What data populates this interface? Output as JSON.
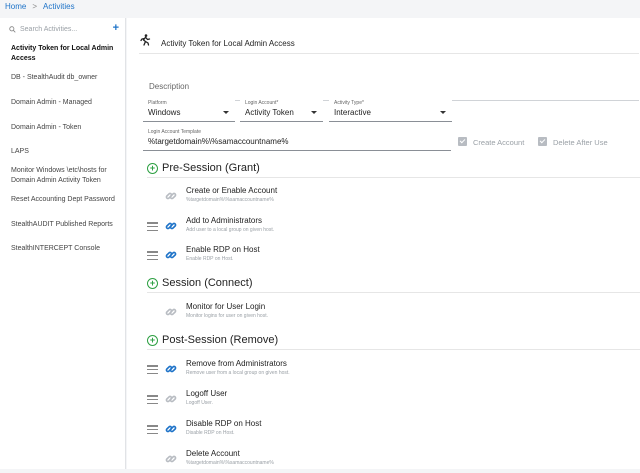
{
  "breadcrumb": {
    "home": "Home",
    "current": "Activities",
    "separator": ">"
  },
  "sidebar": {
    "search_placeholder": "Search Activities...",
    "add_label": "+",
    "items": [
      {
        "label": "Activity Token for Local Admin Access"
      },
      {
        "label": "DB - StealthAudit db_owner"
      },
      {
        "label": "Domain Admin - Managed"
      },
      {
        "label": "Domain Admin - Token"
      },
      {
        "label": "LAPS"
      },
      {
        "label": "Monitor Windows \\etc\\hosts for Domain Admin Activity Token"
      },
      {
        "label": "Reset Accounting Dept Password"
      },
      {
        "label": "StealthAUDIT Published Reports"
      },
      {
        "label": "StealthINTERCEPT Console"
      }
    ]
  },
  "activity": {
    "title": "Activity Token for Local Admin Access",
    "description_placeholder": "Description",
    "platform": {
      "label": "Platform",
      "value": "Windows"
    },
    "login_account": {
      "label": "Login Account*",
      "value": "Activity Token"
    },
    "activity_type": {
      "label": "Activity Type*",
      "value": "Interactive"
    },
    "login_template": {
      "label": "Login Account Template",
      "value": "%targetdomain%\\%samaccountname%"
    },
    "create_account_label": "Create Account",
    "delete_after_use_label": "Delete After Use"
  },
  "sections": {
    "pre": {
      "title": "Pre-Session (Grant)",
      "actions": [
        {
          "name": "Create or Enable Account",
          "desc": "%targetdomain%\\%samaccountname%"
        },
        {
          "name": "Add to Administrators",
          "desc": "Add user to a local group on given host."
        },
        {
          "name": "Enable RDP on Host",
          "desc": "Enable RDP on Host."
        }
      ]
    },
    "session": {
      "title": "Session (Connect)",
      "actions": [
        {
          "name": "Monitor for User Login",
          "desc": "Monitor logins for user on given host."
        }
      ]
    },
    "post": {
      "title": "Post-Session (Remove)",
      "actions": [
        {
          "name": "Remove from Administrators",
          "desc": "Remove user from a local group on given host."
        },
        {
          "name": "Logoff User",
          "desc": "Logoff User."
        },
        {
          "name": "Disable RDP on Host",
          "desc": "Disable RDP on Host."
        },
        {
          "name": "Delete Account",
          "desc": "%targetdomain%\\%samaccountname%"
        }
      ]
    }
  },
  "icons": {
    "search": "search-icon",
    "runner": "runner-icon",
    "link": "link-icon",
    "grip": "drag-handle-icon",
    "add_section": "plus-circle-icon"
  },
  "colors": {
    "accent": "#1e73c8",
    "section_plus": "#2ea043",
    "link_active": "#1e73c8",
    "link_inactive": "#b8bcc2",
    "checkbox_disabled": "#b8bcc2"
  }
}
